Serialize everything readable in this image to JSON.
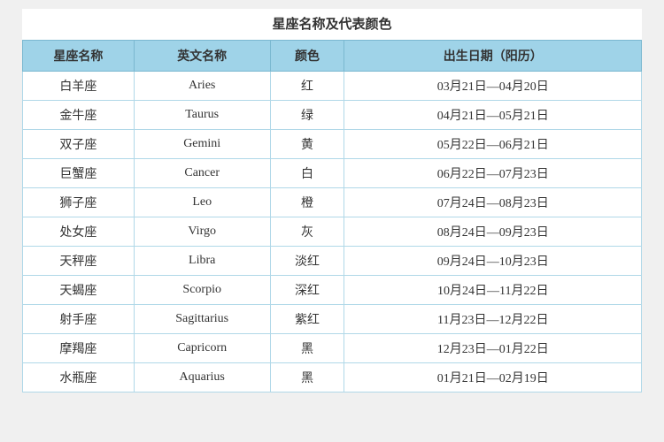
{
  "title": "星座名称及代表颜色",
  "header": {
    "col1": "星座名称",
    "col2": "英文名称",
    "col3": "颜色",
    "col4": "出生日期（阳历）"
  },
  "rows": [
    {
      "name": "白羊座",
      "en": "Aries",
      "color": "红",
      "date": "03月21日—04月20日"
    },
    {
      "name": "金牛座",
      "en": "Taurus",
      "color": "绿",
      "date": "04月21日—05月21日"
    },
    {
      "name": "双子座",
      "en": "Gemini",
      "color": "黄",
      "date": "05月22日—06月21日"
    },
    {
      "name": "巨蟹座",
      "en": "Cancer",
      "color": "白",
      "date": "06月22日—07月23日"
    },
    {
      "name": "狮子座",
      "en": "Leo",
      "color": "橙",
      "date": "07月24日—08月23日"
    },
    {
      "name": "处女座",
      "en": "Virgo",
      "color": "灰",
      "date": "08月24日—09月23日"
    },
    {
      "name": "天秤座",
      "en": "Libra",
      "color": "淡红",
      "date": "09月24日—10月23日"
    },
    {
      "name": "天蝎座",
      "en": "Scorpio",
      "color": "深红",
      "date": "10月24日—11月22日"
    },
    {
      "name": "射手座",
      "en": "Sagittarius",
      "color": "紫红",
      "date": "11月23日—12月22日"
    },
    {
      "name": "摩羯座",
      "en": "Capricorn",
      "color": "黑",
      "date": "12月23日—01月22日"
    },
    {
      "name": "水瓶座",
      "en": "Aquarius",
      "color": "黑",
      "date": "01月21日—02月19日"
    }
  ]
}
